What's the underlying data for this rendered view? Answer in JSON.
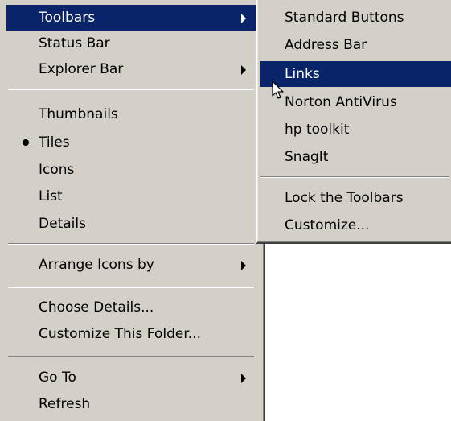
{
  "main_menu": {
    "toolbars": "Toolbars",
    "status_bar": "Status Bar",
    "explorer_bar": "Explorer Bar",
    "thumbnails": "Thumbnails",
    "tiles": "Tiles",
    "icons": "Icons",
    "list": "List",
    "details": "Details",
    "arrange_icons_by": "Arrange Icons by",
    "choose_details": "Choose Details...",
    "customize_folder": "Customize This Folder...",
    "go_to": "Go To",
    "refresh": "Refresh"
  },
  "toolbars_submenu": {
    "standard_buttons": "Standard Buttons",
    "address_bar": "Address Bar",
    "links": "Links",
    "norton_antivirus": "Norton AntiVirus",
    "hp_toolkit": "hp toolkit",
    "snagit": "SnagIt",
    "lock_toolbars": "Lock the Toolbars",
    "customize": "Customize..."
  },
  "colors": {
    "menu_background": "#d4d0c8",
    "highlight": "#0a246a",
    "highlight_text": "#ffffff"
  },
  "icons": [
    "submenu-arrow-icon",
    "radio-bullet-icon",
    "mouse-cursor-icon"
  ]
}
